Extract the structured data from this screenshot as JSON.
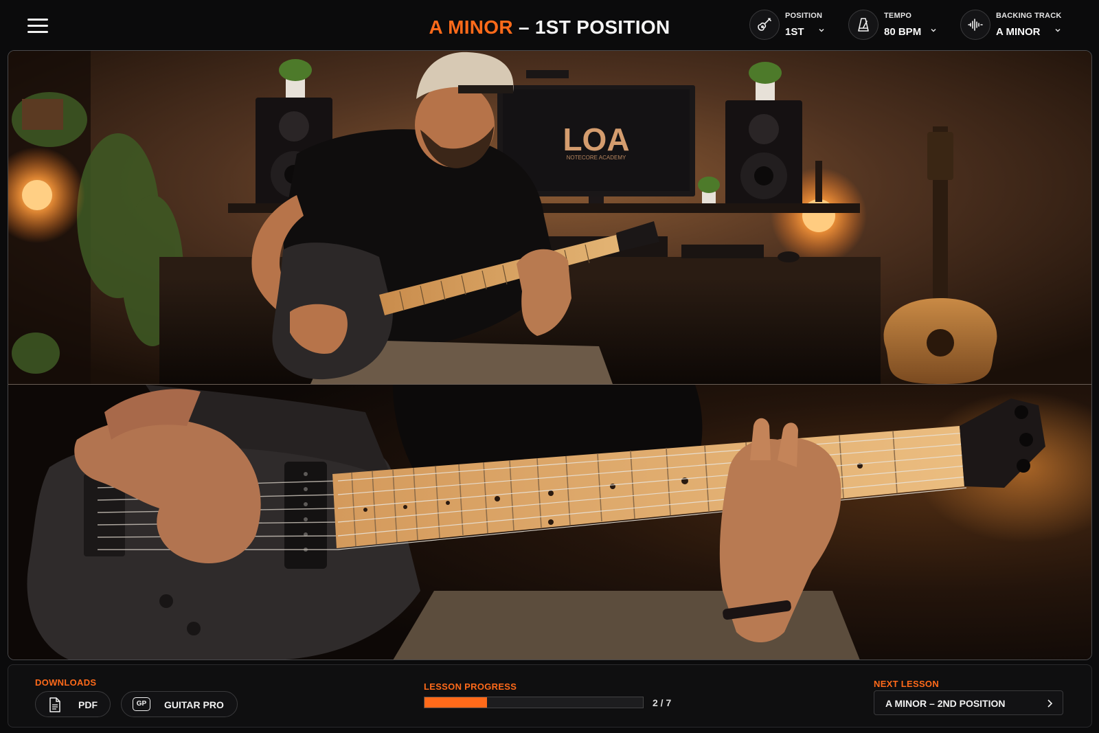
{
  "header": {
    "title_accent": "A MINOR",
    "title_rest": " – 1ST POSITION",
    "menu_icon": "hamburger-menu-icon",
    "controls": [
      {
        "label": "POSITION",
        "value": "1ST",
        "icon": "guitar-icon"
      },
      {
        "label": "TEMPO",
        "value": "80 BPM",
        "icon": "metronome-icon"
      },
      {
        "label": "BACKING TRACK",
        "value": "A MINOR",
        "icon": "waveform-icon"
      }
    ]
  },
  "video": {
    "monitor_logo": "LOA",
    "monitor_subtitle": "NOTECORE ACADEMY"
  },
  "footer": {
    "downloads": {
      "label": "DOWNLOADS",
      "pdf": {
        "label": "PDF",
        "icon": "document-icon"
      },
      "guitar_pro": {
        "label": "GUITAR PRO",
        "icon_text": "GP"
      }
    },
    "progress": {
      "label": "LESSON PROGRESS",
      "current": 2,
      "total": 7,
      "text": "2 / 7"
    },
    "next_lesson": {
      "label": "NEXT LESSON",
      "title": "A MINOR – 2ND POSITION",
      "icon": "chevron-right-icon"
    }
  },
  "colors": {
    "accent": "#ff6a1a",
    "background": "#0b0b0c",
    "text": "#f2f2f2"
  }
}
